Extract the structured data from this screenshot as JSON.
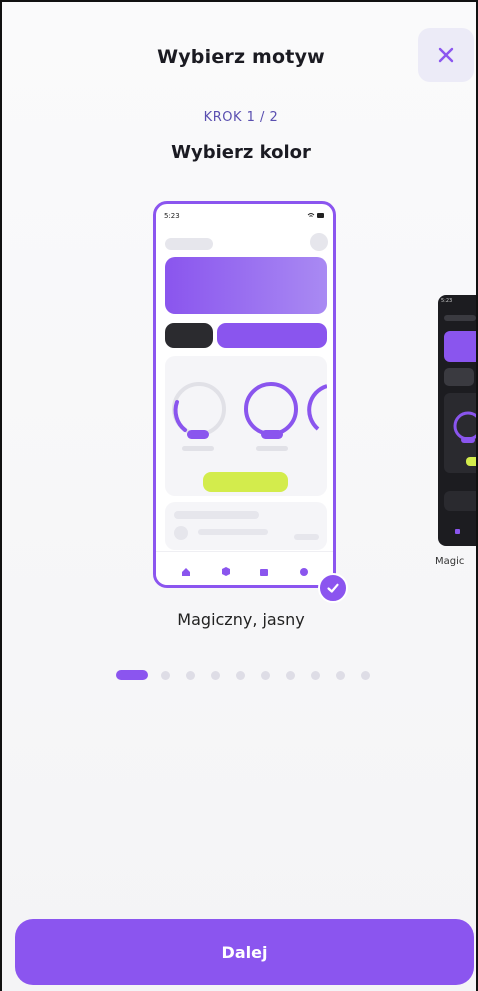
{
  "header": {
    "title": "Wybierz motyw",
    "close_icon": "close-icon"
  },
  "step": {
    "label": "KROK 1 / 2",
    "title": "Wybierz kolor"
  },
  "themes": [
    {
      "name": "Magiczny, jasny",
      "status_time": "5:23",
      "selected": true
    },
    {
      "name": "Magic",
      "status_time": "5:23",
      "selected": false
    }
  ],
  "pagination": {
    "total": 11,
    "current": 1
  },
  "actions": {
    "next_label": "Dalej"
  },
  "colors": {
    "accent": "#8b55ef",
    "lime": "#d3ec4c",
    "dark": "#1c1c20"
  }
}
